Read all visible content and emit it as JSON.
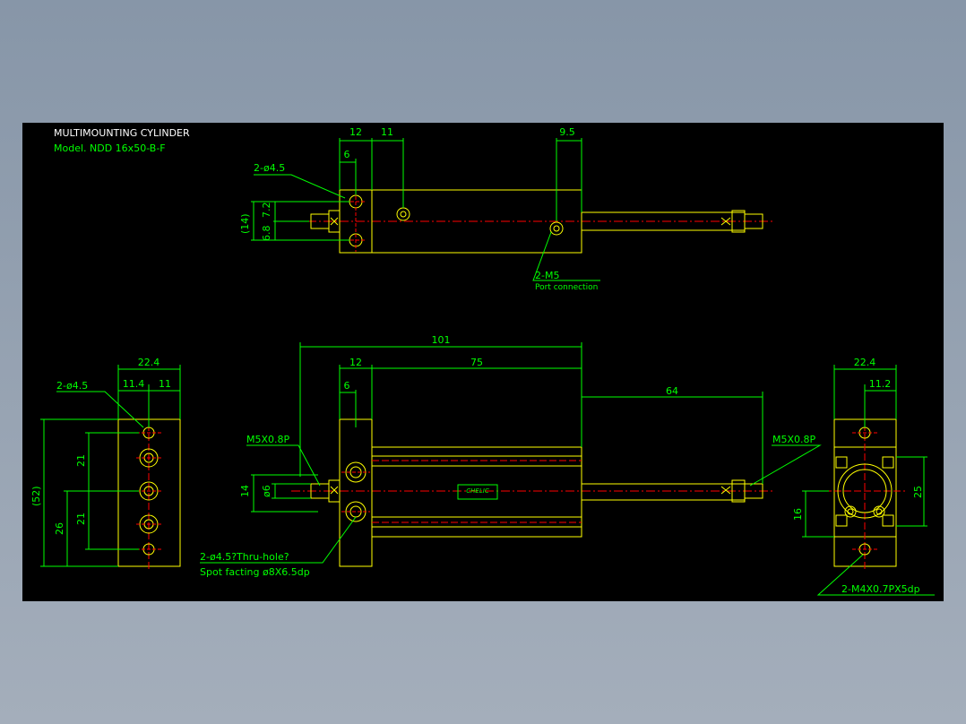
{
  "title": {
    "line1": "MULTIMOUNTING CYLINDER",
    "line2": "Model. NDD 16x50-B-F"
  },
  "dims": {
    "top_12": "12",
    "top_11": "11",
    "top_9_5": "9.5",
    "top_6": "6",
    "top_hole": "2-ø4.5",
    "top_14": "(14)",
    "top_6_8": "6.8",
    "top_7_2": "7.2",
    "port_label": "2-M5",
    "port_sub": "Port connection",
    "front_101": "101",
    "front_12": "12",
    "front_75": "75",
    "front_6": "6",
    "front_64": "64",
    "front_m5_left": "M5X0.8P",
    "front_m5_right": "M5X0.8P",
    "front_14": "14",
    "front_d6": "ø6",
    "front_hole": "2-ø4.5?Thru-hole?",
    "front_spot": "Spot facting  ø8X6.5dp",
    "left_22_4": "22.4",
    "left_11_4": "11.4",
    "left_11": "11",
    "left_hole": "2-ø4.5",
    "left_52": "(52)",
    "left_26": "26",
    "left_21a": "21",
    "left_21b": "21",
    "right_22_4": "22.4",
    "right_11_2": "11.2",
    "right_25": "25",
    "right_16": "16",
    "right_tap": "2-M4X0.7PX5dp"
  },
  "logo": "CHELIC",
  "colors": {
    "outline": "#ffff00",
    "dimension": "#00ff00",
    "center": "#ff0000",
    "title": "#ffffff"
  }
}
